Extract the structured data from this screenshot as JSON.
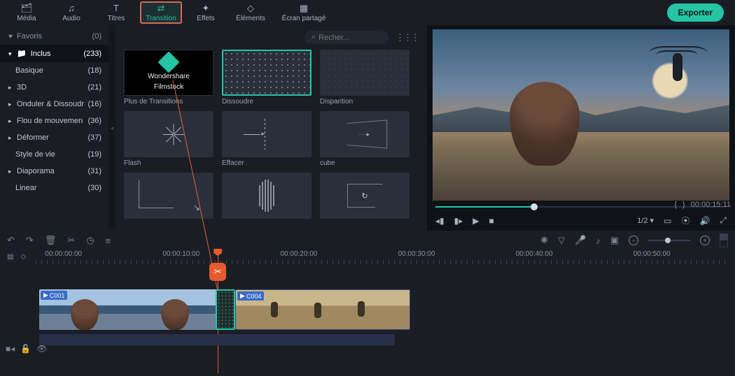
{
  "nav": {
    "items": [
      {
        "name": "media",
        "label": "Média",
        "icon": "🗂"
      },
      {
        "name": "audio",
        "label": "Audio",
        "icon": "♫"
      },
      {
        "name": "titles",
        "label": "Titres",
        "icon": "T"
      },
      {
        "name": "transition",
        "label": "Transition",
        "icon": "⇄"
      },
      {
        "name": "effects",
        "label": "Effets",
        "icon": "✦"
      },
      {
        "name": "elements",
        "label": "Éléments",
        "icon": "◇"
      },
      {
        "name": "split",
        "label": "Écran partagé",
        "icon": "▦"
      }
    ],
    "active_index": 3,
    "export_label": "Exporter"
  },
  "sidebar": {
    "favorites": {
      "label": "Favoris",
      "count": "(0)"
    },
    "inclus": {
      "label": "Inclus",
      "count": "(233)"
    },
    "items": [
      {
        "label": "Basique",
        "count": "(18)",
        "chev": false
      },
      {
        "label": "3D",
        "count": "(21)",
        "chev": true
      },
      {
        "label": "Onduler & Dissoudr",
        "count": "(16)",
        "chev": true
      },
      {
        "label": "Flou de mouvemen",
        "count": "(36)",
        "chev": true
      },
      {
        "label": "Déformer",
        "count": "(37)",
        "chev": true
      },
      {
        "label": "Style de vie",
        "count": "(19)",
        "chev": false
      },
      {
        "label": "Diaporama",
        "count": "(31)",
        "chev": true
      },
      {
        "label": "Linear",
        "count": "(30)",
        "chev": false
      }
    ]
  },
  "browser": {
    "search_placeholder": "Recher...",
    "cards": [
      {
        "key": "ws",
        "label": "Plus de Transitions",
        "ws_line1": "Wondershare",
        "ws_line2": "Filmstock"
      },
      {
        "key": "dissolve",
        "label": "Dissoudre",
        "selected": true
      },
      {
        "key": "disparition",
        "label": "Disparition"
      },
      {
        "key": "flash",
        "label": "Flash"
      },
      {
        "key": "effacer",
        "label": "Effacer"
      },
      {
        "key": "cube",
        "label": "cube"
      },
      {
        "key": "steps",
        "label": ""
      },
      {
        "key": "blinds",
        "label": ""
      },
      {
        "key": "shape",
        "label": ""
      }
    ]
  },
  "preview": {
    "timecode": "00:00:15:11",
    "brackets": {
      "l": "{",
      "r": "}"
    },
    "page": "1/2"
  },
  "ruler": {
    "times": [
      "00:00:00:00",
      "00:00:10:00",
      "00:00:20:00",
      "00:00:30:00",
      "00:00:40:00",
      "00:00:50:00"
    ]
  },
  "clips": {
    "c1": "C001",
    "c2": "C004"
  }
}
